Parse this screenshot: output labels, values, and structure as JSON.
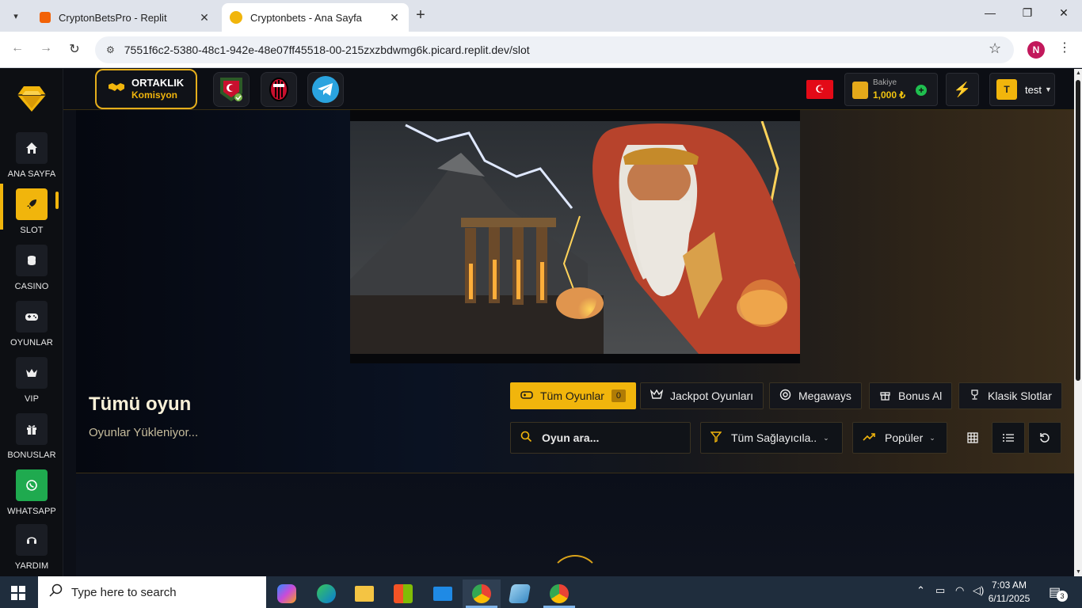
{
  "browser": {
    "tabs": [
      {
        "title": "CryptonBetsPro - Replit",
        "active": false
      },
      {
        "title": "Cryptonbets - Ana Sayfa",
        "active": true
      }
    ],
    "url": "7551f6c2-5380-48c1-942e-48e07ff45518-00-215zxzbdwmg6k.picard.replit.dev/slot",
    "profile_initial": "N"
  },
  "sidebar": {
    "items": [
      {
        "label": "ANA SAYFA",
        "icon": "home-icon"
      },
      {
        "label": "SLOT",
        "icon": "rocket-icon",
        "active": true
      },
      {
        "label": "CASINO",
        "icon": "coins-icon"
      },
      {
        "label": "OYUNLAR",
        "icon": "gamepad-icon"
      },
      {
        "label": "VIP",
        "icon": "crown-icon"
      },
      {
        "label": "BONUSLAR",
        "icon": "gift-icon"
      },
      {
        "label": "WHATSAPP",
        "icon": "whatsapp-icon"
      },
      {
        "label": "YARDIM",
        "icon": "headset-icon"
      }
    ]
  },
  "topbar": {
    "partner_title": "ORTAKLIK",
    "partner_subtitle": "Komisyon",
    "balance_label": "Bakiye",
    "balance_value": "1,000 ₺",
    "user_initial": "T",
    "username": "test"
  },
  "main": {
    "title": "Tümü oyun",
    "loading_text": "Oyunlar Yükleniyor...",
    "categories": [
      {
        "label": "Tüm Oyunlar",
        "icon": "gamepad-icon",
        "count": "0",
        "active": true
      },
      {
        "label": "Jackpot Oyunları",
        "icon": "crown-icon"
      },
      {
        "label": "Megaways",
        "icon": "target-icon"
      },
      {
        "label": "Bonus Al",
        "icon": "gift-icon"
      },
      {
        "label": "Klasik Slotlar",
        "icon": "trophy-icon"
      }
    ],
    "search_placeholder": "Oyun ara...",
    "provider_filter": "Tüm Sağlayıcıla..",
    "sort": "Popüler"
  },
  "taskbar": {
    "search_placeholder": "Type here to search",
    "time": "7:03 AM",
    "date": "6/11/2025",
    "notification_count": "3"
  },
  "colors": {
    "accent": "#f1b50c",
    "whatsapp": "#1faa4f"
  }
}
